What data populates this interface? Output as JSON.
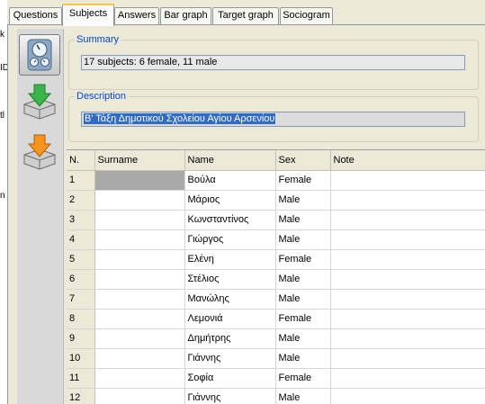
{
  "left_edge": [
    "k",
    "ID",
    "tl",
    "n"
  ],
  "tabs": [
    {
      "label": "Questions",
      "active": false
    },
    {
      "label": "Subjects",
      "active": true
    },
    {
      "label": "Answers",
      "active": false
    },
    {
      "label": "Bar graph",
      "active": false
    },
    {
      "label": "Target graph",
      "active": false
    },
    {
      "label": "Sociogram",
      "active": false
    }
  ],
  "toolbar": {
    "icons": [
      "gauge-icon",
      "import-green-arrow-icon",
      "export-orange-arrow-icon"
    ]
  },
  "summary": {
    "title": "Summary",
    "value": "17 subjects: 6 female, 11 male"
  },
  "description": {
    "title": "Description",
    "value": "Β' Τάξη Δημοτικού Σχολείου Αγίου Αρσενίου"
  },
  "grid": {
    "columns": [
      "N.",
      "Surname",
      "Name",
      "Sex",
      "Note"
    ],
    "rows": [
      {
        "n": "1",
        "surname": "",
        "name": "Βούλα",
        "sex": "Female",
        "note": ""
      },
      {
        "n": "2",
        "surname": "",
        "name": "Μάριος",
        "sex": "Male",
        "note": ""
      },
      {
        "n": "3",
        "surname": "",
        "name": "Κωνσταντίνος",
        "sex": "Male",
        "note": ""
      },
      {
        "n": "4",
        "surname": "",
        "name": "Γιώργος",
        "sex": "Male",
        "note": ""
      },
      {
        "n": "5",
        "surname": "",
        "name": "Ελένη",
        "sex": "Female",
        "note": ""
      },
      {
        "n": "6",
        "surname": "",
        "name": "Στέλιος",
        "sex": "Male",
        "note": ""
      },
      {
        "n": "7",
        "surname": "",
        "name": "Μανώλης",
        "sex": "Male",
        "note": ""
      },
      {
        "n": "8",
        "surname": "",
        "name": "Λεμονιά",
        "sex": "Female",
        "note": ""
      },
      {
        "n": "9",
        "surname": "",
        "name": "Δημήτρης",
        "sex": "Male",
        "note": ""
      },
      {
        "n": "10",
        "surname": "",
        "name": "Γιάννης",
        "sex": "Male",
        "note": ""
      },
      {
        "n": "11",
        "surname": "",
        "name": "Σοφία",
        "sex": "Female",
        "note": ""
      },
      {
        "n": "12",
        "surname": "",
        "name": "Γιάννης",
        "sex": "Male",
        "note": ""
      }
    ]
  }
}
